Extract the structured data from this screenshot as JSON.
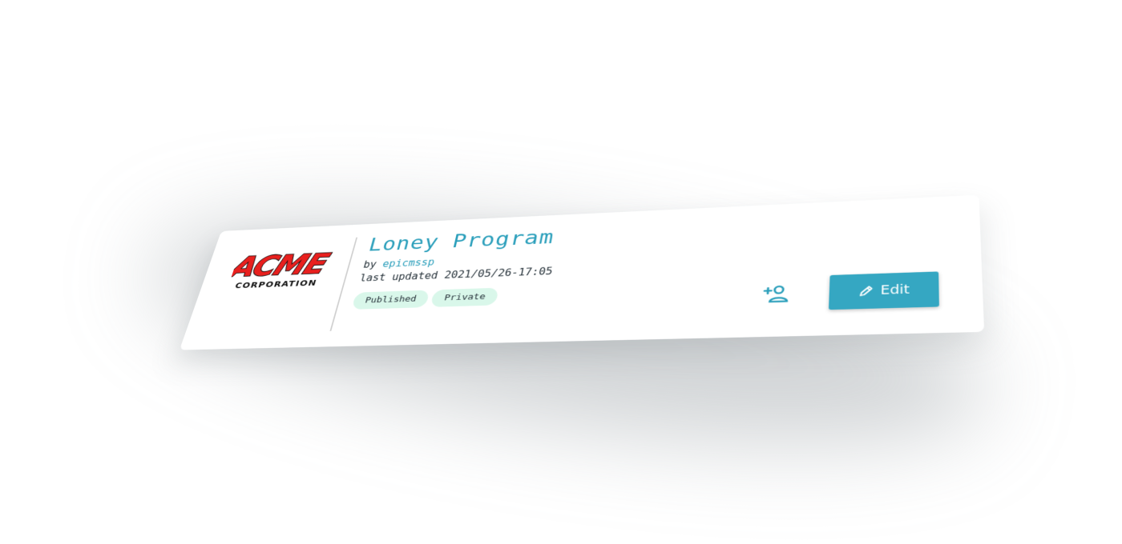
{
  "logo": {
    "name": "acme-corporation-logo",
    "line1": "ACME",
    "line2": "CORPORATION",
    "colors": {
      "fill": "#e8201e",
      "outline": "#111111"
    }
  },
  "program": {
    "title": "Loney Program",
    "by_label": "by",
    "author": "epicmssp",
    "last_updated": "last updated 2021/05/26-17:05"
  },
  "badges": [
    {
      "label": "Published"
    },
    {
      "label": "Private"
    }
  ],
  "actions": {
    "add_member_icon": "person-add-icon",
    "edit_icon": "pencil-icon",
    "edit_label": "Edit"
  },
  "colors": {
    "accent": "#35a7c2",
    "title": "#2b9fbb",
    "badge_bg": "#d9f7ea",
    "text": "#26323a"
  }
}
